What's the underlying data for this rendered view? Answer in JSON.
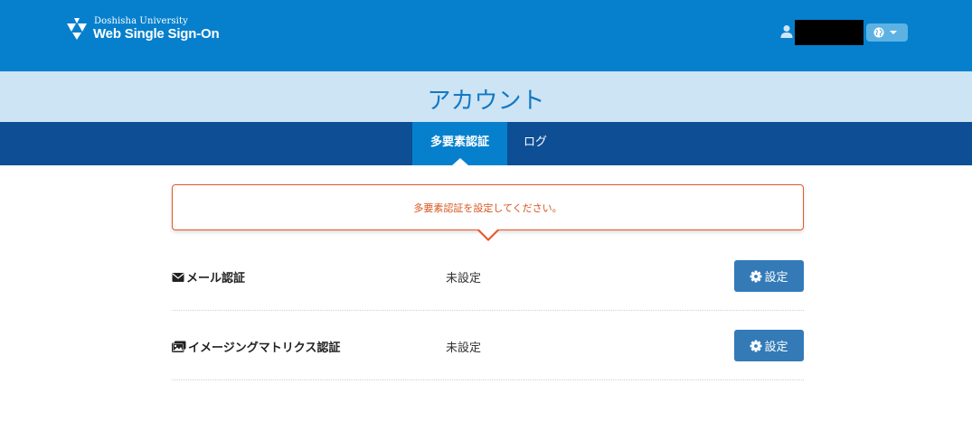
{
  "header": {
    "logo": {
      "small_text": "Doshisha University",
      "big_text": "Web Single Sign-On"
    },
    "language_icon": "globe-icon",
    "user_icon": "user-icon",
    "colors": {
      "header_bg": "#0680cd",
      "lang_button_bg": "#5db2e3"
    }
  },
  "page": {
    "title": "アカウント",
    "title_bg": "#cde4f4"
  },
  "nav": {
    "bg": "#0d4e95",
    "tabs": [
      {
        "label": "多要素認証",
        "active": true
      },
      {
        "label": "ログ",
        "active": false
      }
    ]
  },
  "alert": {
    "message": "多要素認証を設定してください。",
    "color": "#e8562a"
  },
  "methods": [
    {
      "icon": "envelope-icon",
      "label": "メール認証",
      "status": "未設定",
      "button": "設定"
    },
    {
      "icon": "images-icon",
      "label": "イメージングマトリクス認証",
      "status": "未設定",
      "button": "設定"
    }
  ],
  "button_color": "#337ab7"
}
